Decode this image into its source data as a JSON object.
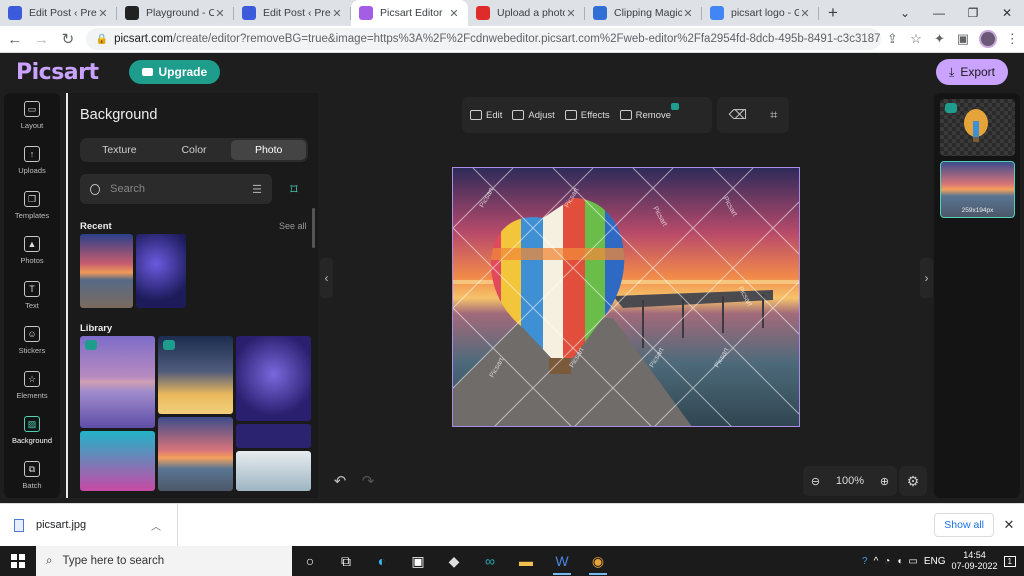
{
  "browser": {
    "tabs": [
      {
        "title": "Edit Post ‹ Predis",
        "icon": "wordpress-icon",
        "color": "#3b5bdb",
        "active": false
      },
      {
        "title": "Playground - Op",
        "icon": "openai-icon",
        "color": "#222222",
        "active": false
      },
      {
        "title": "Edit Post ‹ Predis",
        "icon": "wordpress-icon",
        "color": "#3b5bdb",
        "active": false
      },
      {
        "title": "Picsart Editor",
        "icon": "picsart-icon",
        "color": "#a45ee5",
        "active": true
      },
      {
        "title": "Upload a photo t",
        "icon": "youtube-icon",
        "color": "#e02b2b",
        "active": false
      },
      {
        "title": "Clipping Magic |",
        "icon": "clippingmagic-icon",
        "color": "#2f6fd6",
        "active": false
      },
      {
        "title": "picsart logo - Go",
        "icon": "google-icon",
        "color": "#4285f4",
        "active": false
      }
    ],
    "new_tab_label": "+",
    "url_host": "picsart.com",
    "url_rest": "/create/editor?removeBG=true&image=https%3A%2F%2Fcdnwebeditor.picsart.com%2Fweb-editor%2Ffa2954fd-8dcb-495b-8491-c3c31879fe14.jpg&c..."
  },
  "app": {
    "logo": "Picsart",
    "upgrade_label": "Upgrade",
    "export_label": "Export",
    "rail": [
      {
        "label": "Layout",
        "icon": "layout-icon",
        "glyph": "▭"
      },
      {
        "label": "Uploads",
        "icon": "upload-icon",
        "glyph": "↑"
      },
      {
        "label": "Templates",
        "icon": "templates-icon",
        "glyph": "❐"
      },
      {
        "label": "Photos",
        "icon": "photos-icon",
        "glyph": "▲"
      },
      {
        "label": "Text",
        "icon": "text-icon",
        "glyph": "T"
      },
      {
        "label": "Stickers",
        "icon": "stickers-icon",
        "glyph": "☺"
      },
      {
        "label": "Elements",
        "icon": "star-icon",
        "glyph": "☆"
      },
      {
        "label": "Background",
        "icon": "background-icon",
        "glyph": "▨",
        "active": true
      },
      {
        "label": "Batch",
        "icon": "batch-icon",
        "glyph": "⧉"
      }
    ],
    "panel": {
      "title": "Background",
      "tabs": [
        "Texture",
        "Color",
        "Photo"
      ],
      "active_tab": "Photo",
      "search_placeholder": "Search",
      "recent_title": "Recent",
      "see_all": "See all",
      "library_title": "Library"
    },
    "canvas_tools": [
      {
        "label": "Edit",
        "icon": "edit-icon"
      },
      {
        "label": "Adjust",
        "icon": "adjust-icon"
      },
      {
        "label": "Effects",
        "icon": "effects-icon"
      },
      {
        "label": "Remove",
        "icon": "remove-icon"
      }
    ],
    "watermark": "Picsart",
    "zoom": "100%",
    "layer_size": "259x194px"
  },
  "download": {
    "filename": "picsart.jpg",
    "show_all": "Show all"
  },
  "taskbar": {
    "search_placeholder": "Type here to search",
    "lang": "ENG",
    "time": "14:54",
    "date": "07-09-2022",
    "notifications": "1"
  }
}
